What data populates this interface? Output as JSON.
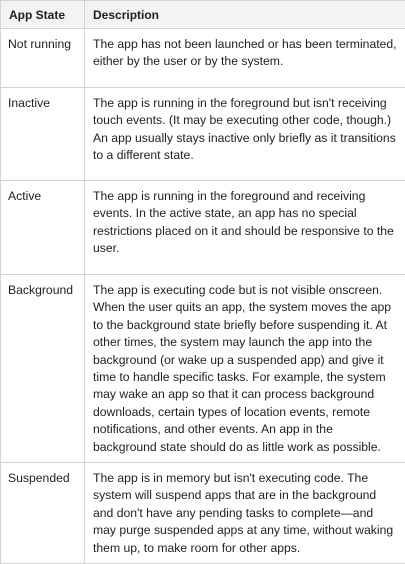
{
  "table": {
    "headers": [
      "App State",
      "Description"
    ],
    "rows": [
      {
        "state": "Not running",
        "description": "The app has not been launched or has been terminated, either by the user or by the system."
      },
      {
        "state": "Inactive",
        "description": "The app is running in the foreground but isn't receiving touch events. (It may be executing other code, though.) An app usually stays inactive only briefly as it transitions to a different state."
      },
      {
        "state": "Active",
        "description": "The app is running in the foreground and receiving events. In the active state, an app has no special restrictions placed on it and should be responsive to the user."
      },
      {
        "state": "Background",
        "description": "The app is executing code but is not visible onscreen. When the user quits an app, the system moves the app to the background state briefly before suspending it. At other times, the system may launch the app into the background (or wake up a suspended app) and give it time to handle specific tasks. For example, the system may wake an app so that it can process background downloads, certain types of location events, remote notifications, and other events. An app in the background state should do as little work as possible."
      },
      {
        "state": "Suspended",
        "description": "The app is in memory but isn't executing code. The system will suspend apps that are in the background and don't have any pending tasks to complete—and may purge suspended apps at any time, without waking them up, to make room for other apps."
      }
    ]
  }
}
